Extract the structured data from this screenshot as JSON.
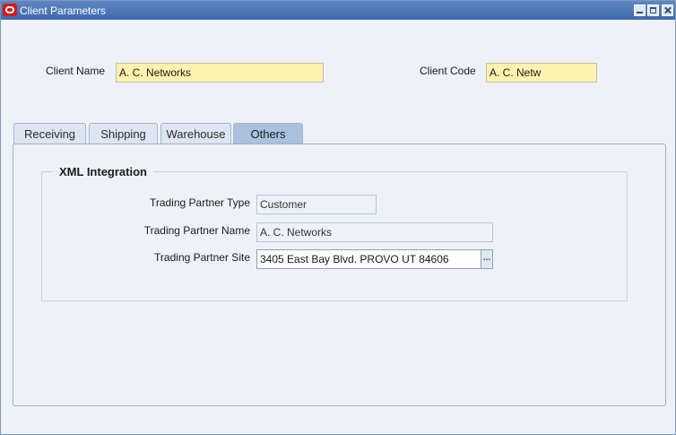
{
  "window": {
    "title": "Client Parameters",
    "controls": [
      "minimize-icon",
      "maximize-icon",
      "close-icon"
    ]
  },
  "header": {
    "client_name_label": "Client Name",
    "client_name_value": "A. C. Networks",
    "client_code_label": "Client Code",
    "client_code_value": "A. C. Netw"
  },
  "tabs": [
    {
      "label": "Receiving",
      "active": false
    },
    {
      "label": "Shipping",
      "active": false
    },
    {
      "label": "Warehouse",
      "active": false
    },
    {
      "label": "Others",
      "active": true
    }
  ],
  "others": {
    "group_title": "XML Integration",
    "trading_partner_type_label": "Trading Partner Type",
    "trading_partner_type_value": "Customer",
    "trading_partner_name_label": "Trading Partner Name",
    "trading_partner_name_value": "A. C. Networks",
    "trading_partner_site_label": "Trading Partner Site",
    "trading_partner_site_value": "3405 East Bay Blvd.  PROVO UT 84606",
    "lov_button_label": "..."
  },
  "colors": {
    "titlebar": "#4a74b8",
    "background": "#eef2f8",
    "required_field": "#fff2b0",
    "active_tab": "#a9c0de"
  }
}
